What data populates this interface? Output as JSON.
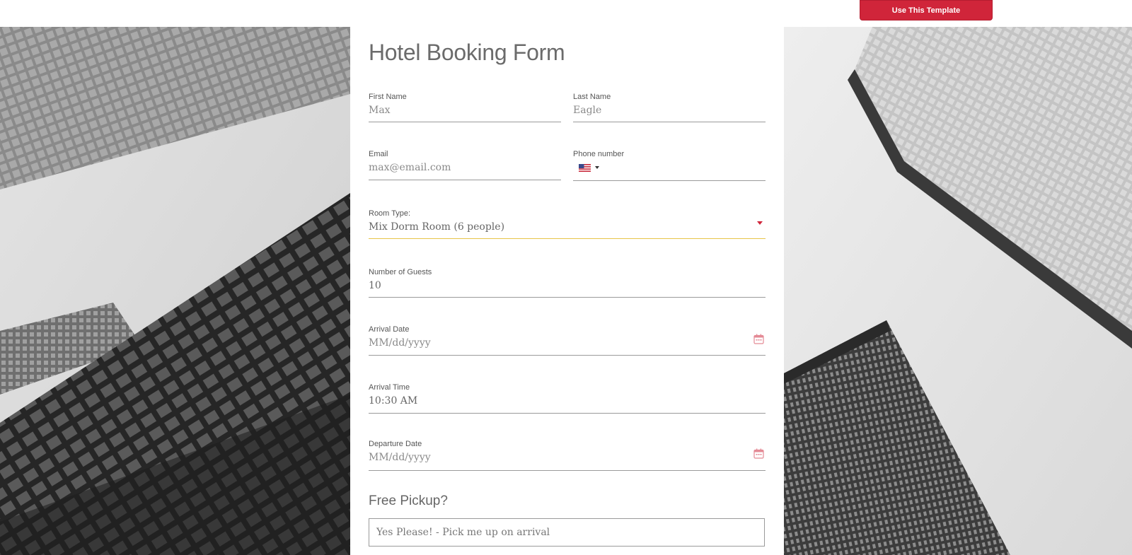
{
  "header": {
    "cta_label": "Use This Template"
  },
  "form": {
    "title": "Hotel Booking Form",
    "first_name": {
      "label": "First Name",
      "value": "Max"
    },
    "last_name": {
      "label": "Last Name",
      "value": "Eagle"
    },
    "email": {
      "label": "Email",
      "value": "max@email.com"
    },
    "phone": {
      "label": "Phone number",
      "value": "",
      "country_flag": "us-flag-icon"
    },
    "room_type": {
      "label": "Room Type:",
      "value": "Mix Dorm Room (6 people)"
    },
    "guests": {
      "label": "Number of Guests",
      "value": "10"
    },
    "arrival_date": {
      "label": "Arrival Date",
      "placeholder": "MM/dd/yyyy"
    },
    "arrival_time": {
      "label": "Arrival Time",
      "value": "10:30 AM"
    },
    "departure_date": {
      "label": "Departure Date",
      "placeholder": "MM/dd/yyyy"
    },
    "pickup": {
      "heading": "Free Pickup?",
      "value": "Yes Please! - Pick me up on arrival"
    }
  },
  "colors": {
    "accent": "#d0253a",
    "active_underline": "#e8c548",
    "text": "#6b6b6b"
  }
}
